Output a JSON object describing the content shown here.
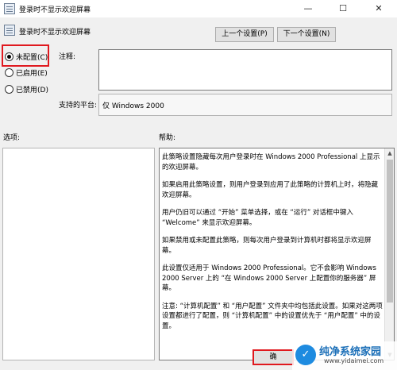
{
  "window": {
    "title": "登录时不显示欢迎屏幕",
    "minimize_glyph": "—",
    "maximize_glyph": "☐",
    "close_glyph": "✕"
  },
  "header": {
    "title": "登录时不显示欢迎屏幕",
    "prev_button": "上一个设置(P)",
    "next_button": "下一个设置(N)"
  },
  "options": [
    {
      "label": "未配置(C)",
      "checked": true
    },
    {
      "label": "已启用(E)",
      "checked": false
    },
    {
      "label": "已禁用(D)",
      "checked": false
    }
  ],
  "comment": {
    "label": "注释:",
    "value": ""
  },
  "supported": {
    "label": "支持的平台:",
    "value": "仅 Windows 2000"
  },
  "sections": {
    "options_label": "选项:",
    "help_label": "帮助:"
  },
  "help_paragraphs": [
    "此策略设置隐藏每次用户登录时在 Windows 2000 Professional 上显示的欢迎屏幕。",
    "如果启用此策略设置，则用户登录到应用了此策略的计算机上时，将隐藏欢迎屏幕。",
    "用户仍旧可以通过 “开始” 菜单选择，或在 “运行” 对话框中键入 “Welcome” 来显示欢迎屏幕。",
    "如果禁用或未配置此策略，则每次用户登录到计算机时都将显示欢迎屏幕。",
    "此设置仅适用于 Windows 2000 Professional。它不会影响 Windows 2000 Server 上的 “在 Windows 2000 Server 上配置你的服务器” 屏幕。",
    "注意: “计算机配置” 和 “用户配置” 文件夹中均包括此设置。如果对这两项设置都进行了配置，则 “计算机配置” 中的设置优先于 “用户配置” 中的设置。"
  ],
  "footer": {
    "ok_button": "确"
  },
  "watermark": {
    "logo_glyph": "✓",
    "name": "纯净系统家园",
    "url": "www.yidaimei.com"
  },
  "colors": {
    "highlight": "#e0191f",
    "watermark_blue": "#1b6fb8"
  }
}
